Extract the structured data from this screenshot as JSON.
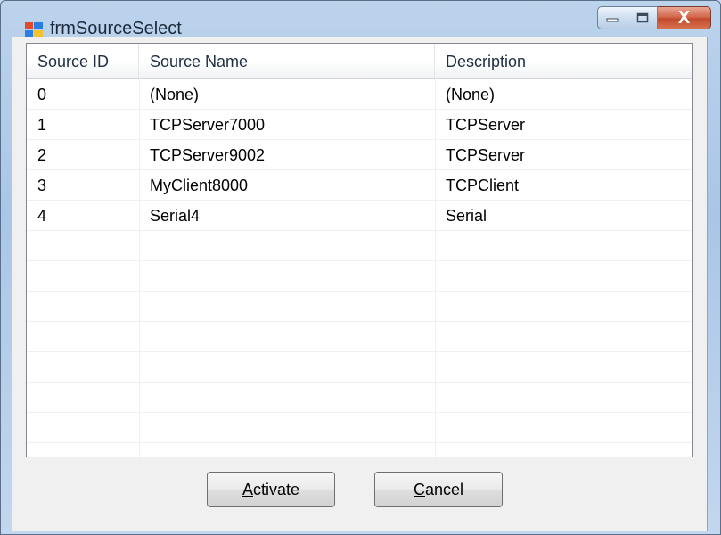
{
  "window": {
    "title": "frmSourceSelect",
    "close_glyph": "X"
  },
  "icons": {
    "app": "form-icon",
    "minimize": "minimize-icon",
    "maximize": "maximize-icon",
    "close": "close-icon"
  },
  "table": {
    "columns": [
      "Source ID",
      "Source Name",
      "Description"
    ],
    "rows": [
      [
        "0",
        "(None)",
        "(None)"
      ],
      [
        "1",
        "TCPServer7000",
        "TCPServer"
      ],
      [
        "2",
        "TCPServer9002",
        "TCPServer"
      ],
      [
        "3",
        "MyClient8000",
        "TCPClient"
      ],
      [
        "4",
        "Serial4",
        "Serial"
      ]
    ]
  },
  "buttons": {
    "activate": {
      "mnemonic": "A",
      "rest": "ctivate"
    },
    "cancel": {
      "mnemonic": "C",
      "rest": "ancel"
    }
  }
}
